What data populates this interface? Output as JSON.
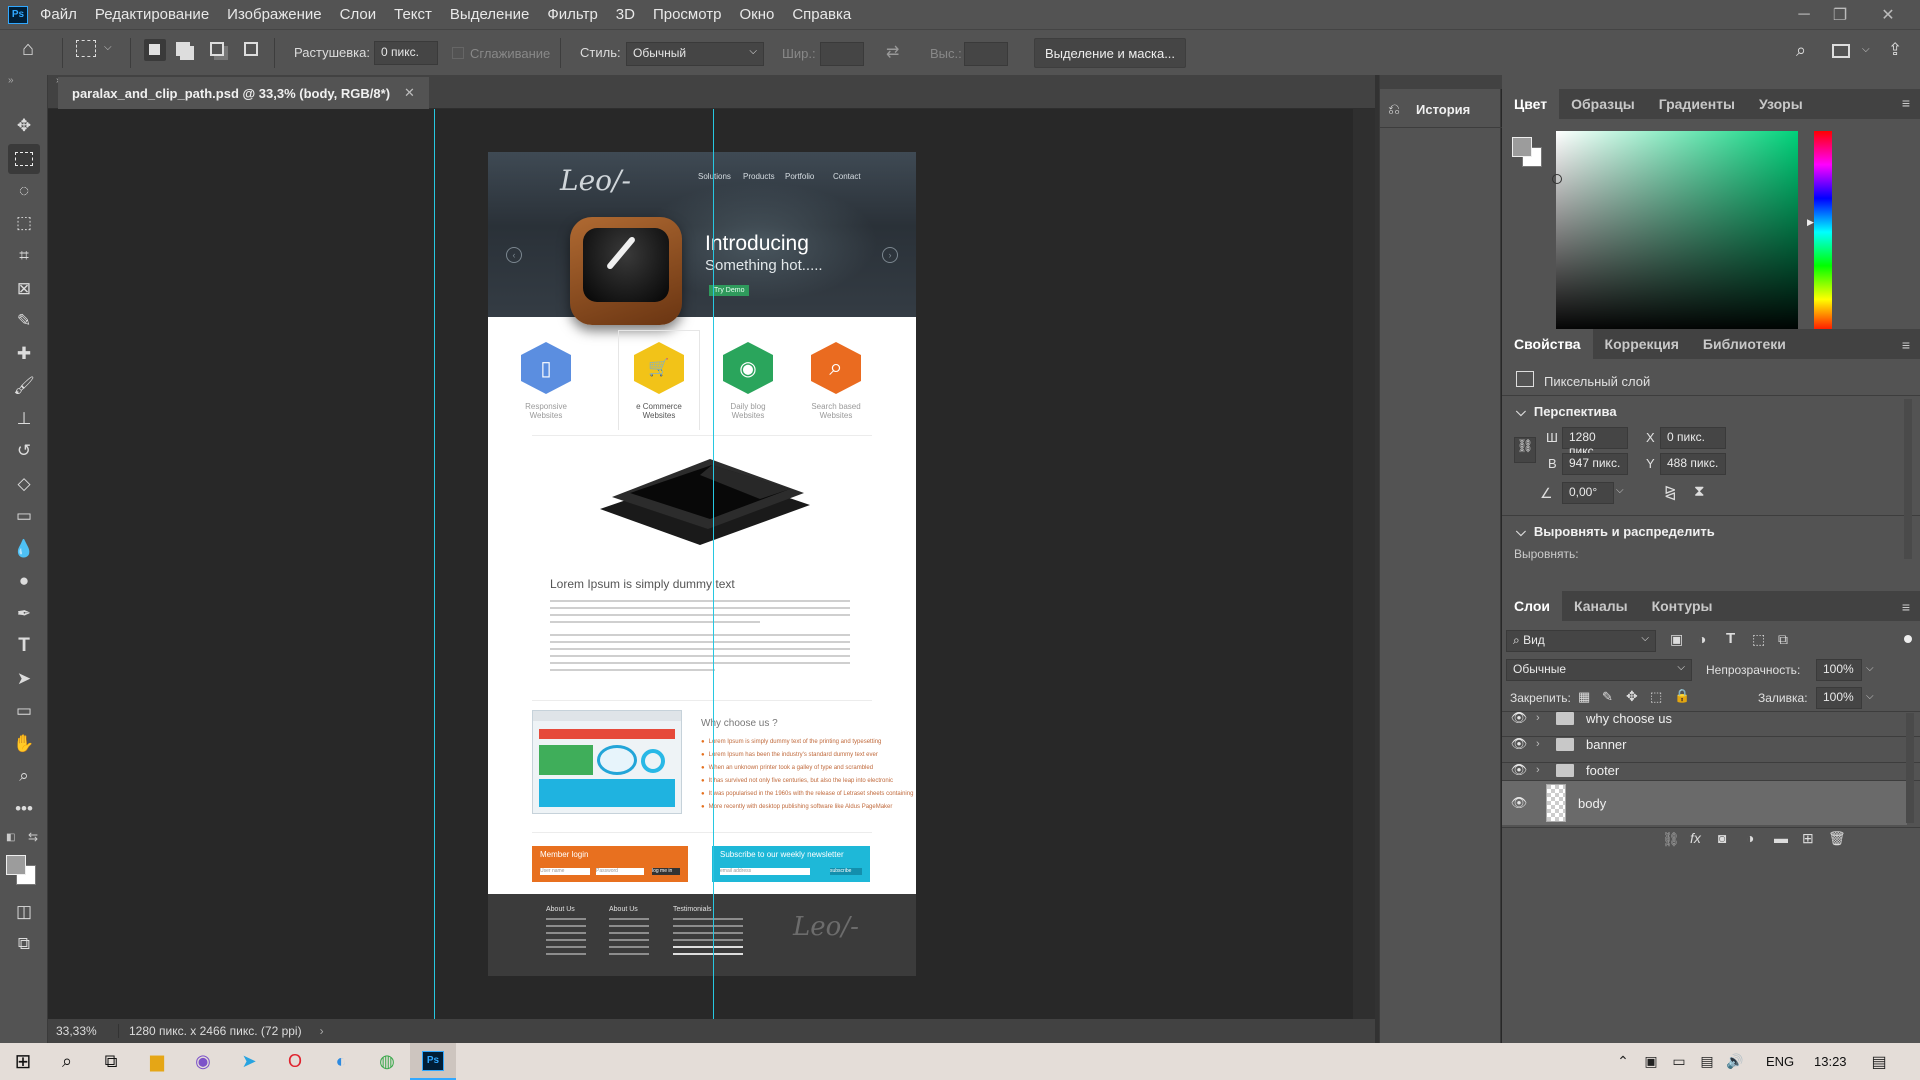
{
  "menu": [
    "Файл",
    "Редактирование",
    "Изображение",
    "Слои",
    "Текст",
    "Выделение",
    "Фильтр",
    "3D",
    "Просмотр",
    "Окно",
    "Справка"
  ],
  "app_icon": "Ps",
  "options": {
    "feather_label": "Растушевка:",
    "feather_value": "0 пикс.",
    "antialias_label": "Сглаживание",
    "style_label": "Стиль:",
    "style_value": "Обычный",
    "width_label": "Шир.:",
    "height_label": "Выс.:",
    "select_mask_button": "Выделение и маска..."
  },
  "document": {
    "tab_title": "paralax_and_clip_path.psd @ 33,3% (body, RGB/8*)",
    "zoom": "33,33%",
    "info": "1280 пикс. x 2466 пикс. (72 ppi)"
  },
  "mockup": {
    "logo": "Leo/-",
    "nav": [
      "Solutions",
      "Products",
      "Portfolio",
      "Contact"
    ],
    "hero_title": "Introducing",
    "hero_subtitle": "Something hot.....",
    "hero_button": "Try Demo",
    "features": [
      {
        "line1": "Responsive",
        "line2": "Websites",
        "color": "#5b8ee0",
        "icon": "▯"
      },
      {
        "line1": "e Commerce",
        "line2": "Websites",
        "color": "#f2c318",
        "icon": "🛒"
      },
      {
        "line1": "Daily blog",
        "line2": "Websites",
        "color": "#2aa55c",
        "icon": "◉"
      },
      {
        "line1": "Search based",
        "line2": "Websites",
        "color": "#ea6b20",
        "icon": "⌕"
      }
    ],
    "lorem_title": "Lorem Ipsum is simply dummy text",
    "why_title": "Why choose us ?",
    "why_items": [
      "Lorem Ipsum is simply dummy text of the printing and typesetting",
      "Lorem Ipsum has been the industry's standard dummy text ever",
      "When an unknown printer took a galley of type and scrambled",
      "It has survived not only five centuries, but also the leap into electronic",
      "It was popularised in the 1960s with the release of Letraset sheets containing",
      "More recently with desktop publishing software like Aldus PageMaker"
    ],
    "login_title": "Member login",
    "login_user": "User name",
    "login_pass": "Password",
    "login_btn": "log me in",
    "news_title": "Subscribe to our weekly newsletter",
    "news_input": "email address",
    "news_btn": "subscribe",
    "footer_cols": [
      "About Us",
      "About Us",
      "Testimonials"
    ],
    "footer_logo": "Leo/-"
  },
  "history_panel": {
    "label": "История"
  },
  "color_panel": {
    "tabs": [
      "Цвет",
      "Образцы",
      "Градиенты",
      "Узоры"
    ]
  },
  "properties_panel": {
    "tabs": [
      "Свойства",
      "Коррекция",
      "Библиотеки"
    ],
    "layer_kind": "Пиксельный слой",
    "transform_title": "Перспектива",
    "w_label": "Ш",
    "w_value": "1280 пикс",
    "h_label": "В",
    "h_value": "947 пикс.",
    "x_label": "X",
    "x_value": "0 пикс.",
    "y_label": "Y",
    "y_value": "488 пикс.",
    "angle_value": "0,00°",
    "align_title": "Выровнять и распределить",
    "align_label": "Выровнять:"
  },
  "layers_panel": {
    "tabs": [
      "Слои",
      "Каналы",
      "Контуры"
    ],
    "filter_value": "Вид",
    "blend_mode": "Обычные",
    "opacity_label": "Непрозрачность:",
    "opacity_value": "100%",
    "lock_label": "Закрепить:",
    "fill_label": "Заливка:",
    "fill_value": "100%",
    "layers": [
      {
        "name": "why choose us",
        "type": "group"
      },
      {
        "name": "banner",
        "type": "group"
      },
      {
        "name": "footer",
        "type": "group"
      },
      {
        "name": "body",
        "type": "pixel",
        "selected": true
      }
    ]
  },
  "taskbar": {
    "language": "ENG",
    "time": "13:23"
  },
  "colors": {
    "ui_bg": "#535353",
    "canvas_bg": "#282828",
    "guide": "#27c7e0",
    "accent_orange": "#e8701f",
    "accent_cyan": "#1eb8d8"
  }
}
